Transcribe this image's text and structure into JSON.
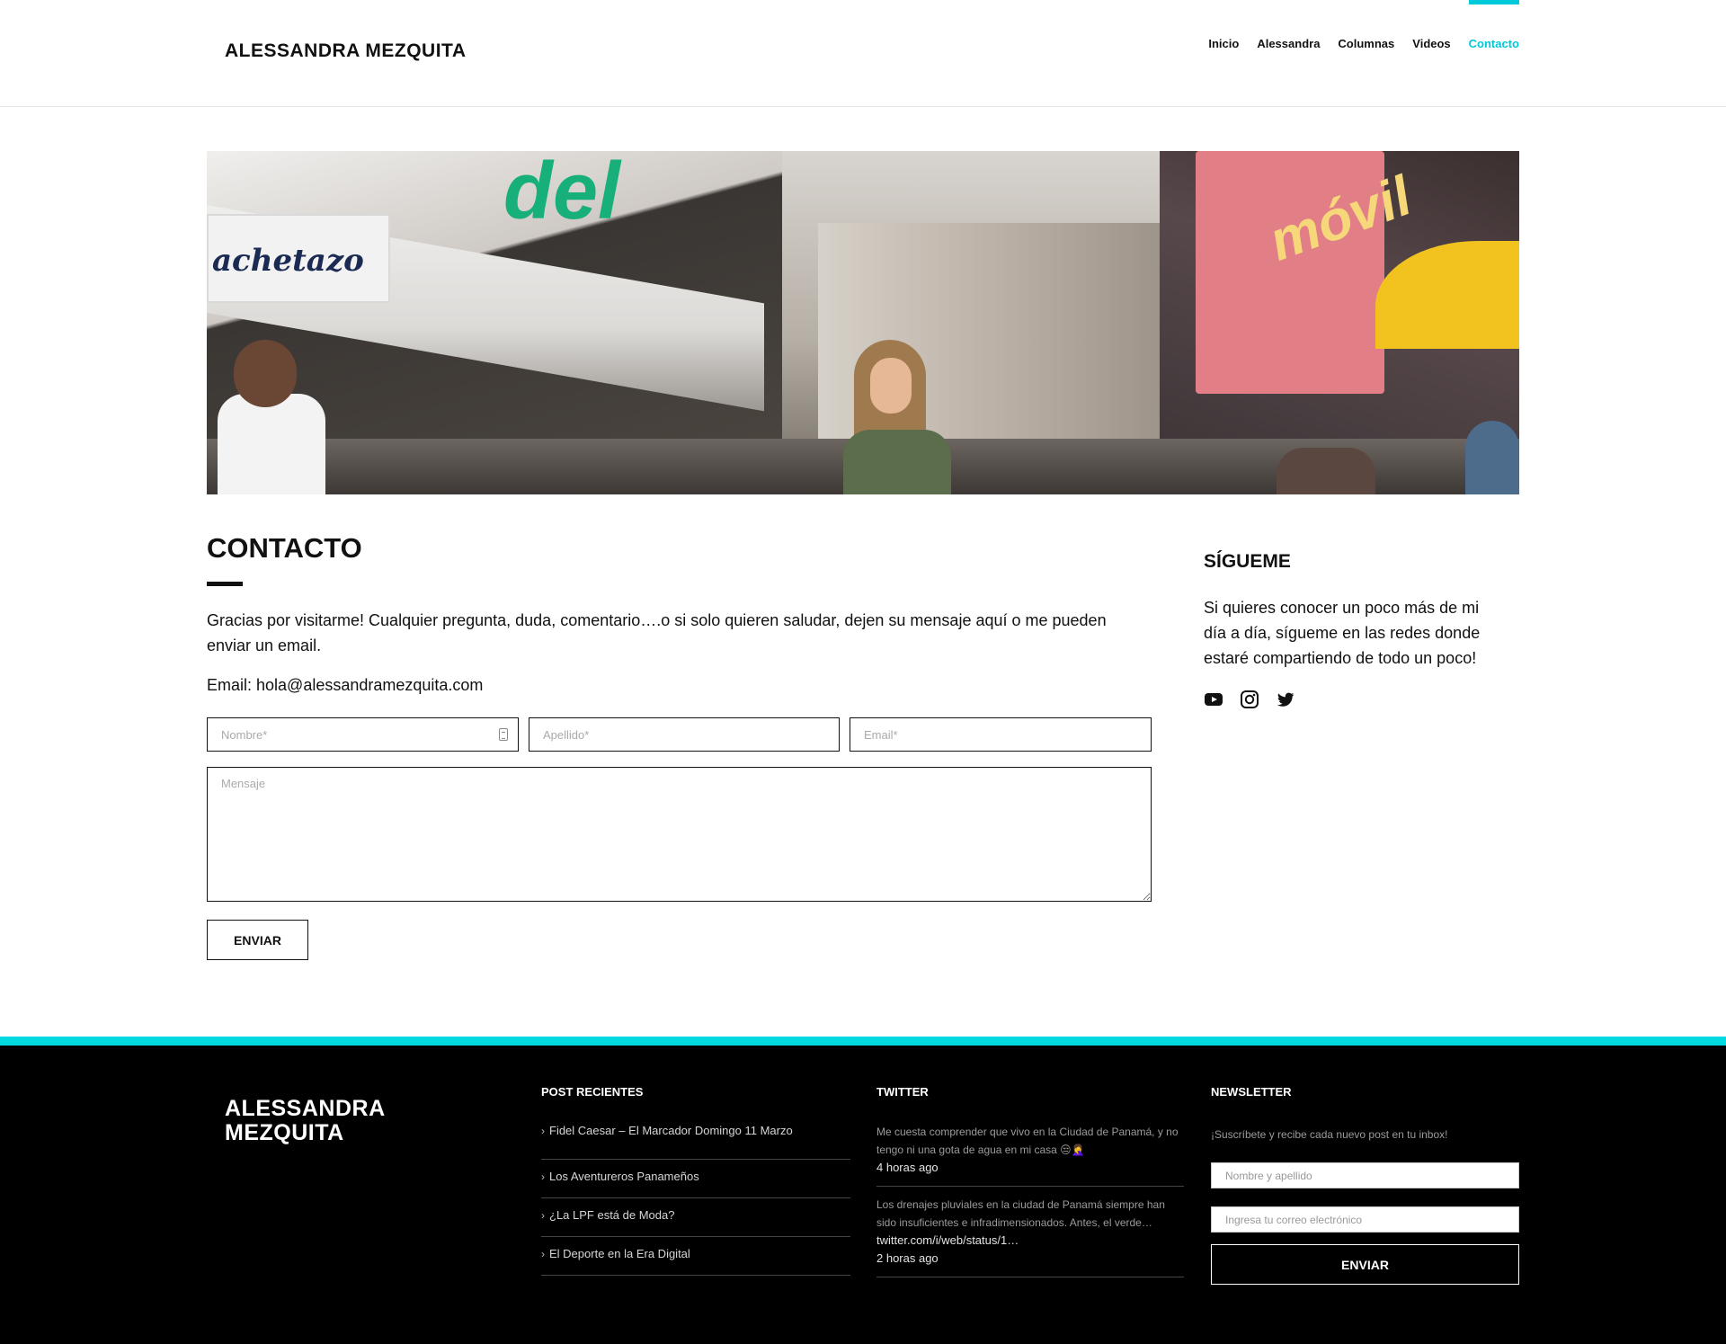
{
  "header": {
    "logo": "ALESSANDRA MEZQUITA",
    "nav": [
      "Inicio",
      "Alessandra",
      "Columnas",
      "Videos",
      "Contacto"
    ],
    "active_nav": "Contacto"
  },
  "main": {
    "title": "CONTACTO",
    "intro": "Gracias por visitarme! Cualquier pregunta, duda, comentario….o si solo quieren saludar, dejen su mensaje aquí o me pueden enviar un email.",
    "email_line": "Email: hola@alessandramezquita.com",
    "form": {
      "nombre_placeholder": "Nombre*",
      "apellido_placeholder": "Apellido*",
      "email_placeholder": "Email*",
      "mensaje_placeholder": "Mensaje",
      "submit_label": "ENVIAR"
    }
  },
  "sidebar": {
    "title": "SÍGUEME",
    "text": "Si quieres conocer un poco más de mi día a día, sígueme en las redes donde estaré compartiendo de todo un poco!",
    "social_icons": [
      "youtube-icon",
      "instagram-icon",
      "twitter-icon"
    ]
  },
  "footer": {
    "logo_line1": "ALESSANDRA",
    "logo_line2": "MEZQUITA",
    "posts_title": "POST RECIENTES",
    "posts": [
      "Fidel Caesar – El Marcador Domingo 11 Marzo",
      "Los Aventureros Panameños",
      "¿La LPF está de Moda?",
      "El Deporte en la Era Digital"
    ],
    "twitter_title": "TWITTER",
    "tweets": [
      {
        "text": "Me cuesta comprender que vivo en la Ciudad de Panamá, y no tengo ni una gota de agua en mi casa 😒🤦‍♀️",
        "link": "",
        "time": "4 horas ago"
      },
      {
        "text": "Los drenajes pluviales en la ciudad de Panamá siempre han sido insuficientes e infradimensionados. Antes, el verde…",
        "link": "twitter.com/i/web/status/1…",
        "time": "2 horas ago"
      }
    ],
    "newsletter_title": "NEWSLETTER",
    "newsletter_text": "¡Suscríbete y recibe cada nuevo post en tu inbox!",
    "newsletter_name_placeholder": "Nombre y apellido",
    "newsletter_email_placeholder": "Ingresa tu correo electrónico",
    "newsletter_submit": "ENVIAR"
  },
  "colors": {
    "accent": "#00c9d9",
    "footer_bg": "#000000",
    "text": "#111111"
  }
}
